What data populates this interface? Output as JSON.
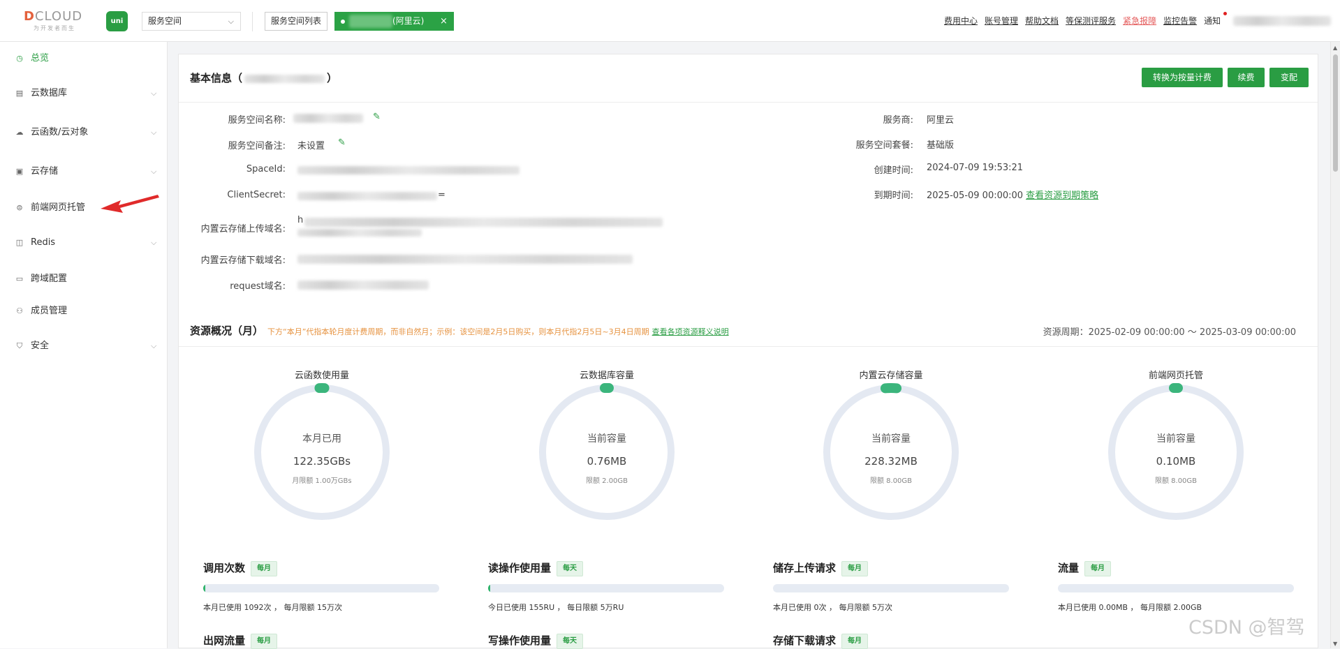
{
  "topbar": {
    "logo_text": "DCLOUD",
    "logo_slogan": "为开发者而生",
    "uni_icon_label": "uni",
    "space_select": "服务空间",
    "space_list_button": "服务空间列表",
    "current_space_suffix": "(阿里云)",
    "close_symbol": "×",
    "links": [
      "费用中心",
      "账号管理",
      "帮助文档",
      "等保测评服务",
      "紧急报障",
      "监控告警"
    ],
    "notify": "通知"
  },
  "sidebar": {
    "items": [
      {
        "label": "总览",
        "icon": "clock-icon",
        "glyph": "◷",
        "active": true
      },
      {
        "label": "云数据库",
        "icon": "database-icon",
        "glyph": "▤",
        "expand": "⌵"
      },
      {
        "label": "云函数/云对象",
        "icon": "cloud-icon",
        "glyph": "☁",
        "expand": "⌵"
      },
      {
        "label": "云存储",
        "icon": "storage-icon",
        "glyph": "▣",
        "expand": "⌵"
      },
      {
        "label": "前端网页托管",
        "icon": "web-hosting-icon",
        "glyph": "⊜"
      },
      {
        "label": "Redis",
        "icon": "redis-icon",
        "glyph": "◫",
        "expand": "⌵"
      },
      {
        "label": "跨域配置",
        "icon": "cors-icon",
        "glyph": "▭"
      },
      {
        "label": "成员管理",
        "icon": "user-icon",
        "glyph": "⚇"
      },
      {
        "label": "安全",
        "icon": "shield-icon",
        "glyph": "⛉",
        "expand": "⌵"
      }
    ]
  },
  "basic": {
    "title_prefix": "基本信息（",
    "title_suffix": "）",
    "buttons": [
      "转换为按量计费",
      "续费",
      "变配"
    ],
    "left": [
      {
        "label": "服务空间名称:",
        "value": ""
      },
      {
        "label": "服务空间备注:",
        "value": "未设置"
      },
      {
        "label": "SpaceId:",
        "value": ""
      },
      {
        "label": "ClientSecret:",
        "value": "="
      },
      {
        "label": "内置云存储上传域名:",
        "value": "h"
      },
      {
        "label": "内置云存储下载域名:",
        "value": ""
      },
      {
        "label": "request域名:",
        "value": ""
      }
    ],
    "right": [
      {
        "label": "服务商:",
        "value": "阿里云"
      },
      {
        "label": "服务空间套餐:",
        "value": "基础版"
      },
      {
        "label": "创建时间:",
        "value": "2024-07-09 19:53:21"
      },
      {
        "label": "到期时间:",
        "value": "2025-05-09 00:00:00",
        "link": "查看资源到期策略"
      }
    ],
    "edit_glyph": "✎"
  },
  "resources": {
    "title": "资源概况（月）",
    "note": "下方“本月”代指本轮月度计费周期，而非自然月；示例：该空间是2月5日购买，则本月代指2月5日~3月4日周期",
    "note_link": "查看各项资源释义说明",
    "period": "资源周期：2025-02-09 00:00:00 ～ 2025-03-09 00:00:00",
    "rings": [
      {
        "title": "云函数使用量",
        "line1": "本月已用",
        "value": "122.35GBs",
        "limit": "月限额 1.00万GBs",
        "fraction": 0.0122
      },
      {
        "title": "云数据库容量",
        "line1": "当前容量",
        "value": "0.76MB",
        "limit": "限额 2.00GB",
        "fraction": 0.0004
      },
      {
        "title": "内置云存储容量",
        "line1": "当前容量",
        "value": "228.32MB",
        "limit": "限额 8.00GB",
        "fraction": 0.0279
      },
      {
        "title": "前端网页托管",
        "line1": "当前容量",
        "value": "0.10MB",
        "limit": "限额 8.00GB",
        "fraction": 1e-05
      }
    ],
    "metrics": [
      {
        "title": "调用次数",
        "badge": "每月",
        "note": "本月已使用 1092次 ， 每月限额 15万次",
        "fraction": 0.0073
      },
      {
        "title": "读操作使用量",
        "badge": "每天",
        "note": "今日已使用 155RU ， 每日限额 5万RU",
        "fraction": 0.0031
      },
      {
        "title": "储存上传请求",
        "badge": "每月",
        "note": "本月已使用 0次 ， 每月限额 5万次",
        "fraction": 0
      },
      {
        "title": "流量",
        "badge": "每月",
        "note": "本月已使用 0.00MB ， 每月限额 2.00GB",
        "fraction": 0
      },
      {
        "title": "出网流量",
        "badge": "每月"
      },
      {
        "title": "写操作使用量",
        "badge": "每天"
      },
      {
        "title": "存储下载请求",
        "badge": "每月"
      }
    ]
  },
  "colors": {
    "accent": "#2a9d43",
    "ring_bg": "#e4e9f2",
    "ring_fg": "#3bb57c",
    "warning": "#e6923f",
    "urgent": "#e45b5b"
  },
  "watermark": "CSDN @智驾",
  "scroll": {
    "up": "▲",
    "down": "▼"
  }
}
